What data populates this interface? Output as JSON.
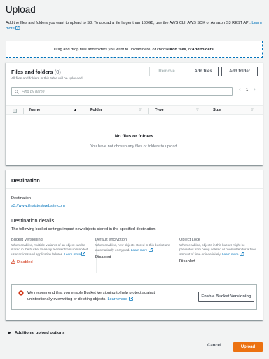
{
  "page": {
    "title": "Upload",
    "intro_text": "Add the files and folders you want to upload to S3. To upload a file larger than 160GB, use the AWS CLI, AWS SDK or Amazon S3 REST API.",
    "intro_link": "Learn more"
  },
  "dropzone": {
    "text_before": "Drag and drop files and folders you want to upload here, or choose ",
    "bold_files": "Add files",
    "text_middle": ", or ",
    "bold_folders": "Add folders",
    "text_after": "."
  },
  "files_panel": {
    "title": "Files and folders",
    "count": "(0)",
    "subtitle": "All files and folders in this table will be uploaded.",
    "remove_label": "Remove",
    "add_files_label": "Add files",
    "add_folder_label": "Add folder",
    "search_placeholder": "Find by name",
    "page_number": "1",
    "columns": [
      "Name",
      "Folder",
      "Type",
      "Size"
    ],
    "empty_title": "No files or folders",
    "empty_text": "You have not chosen any files or folders to upload."
  },
  "destination": {
    "heading": "Destination",
    "label": "Destination",
    "url": "s3://www.thisistestwebsite.com",
    "details_title": "Destination details",
    "details_subtitle": "The following bucket settings impact new objects stored in the specified destination.",
    "columns": [
      {
        "title": "Bucket Versioning",
        "desc": "When enabled, multiple variants of an object can be stored in the bucket to easily recover from unintended user actions and application failures.",
        "link": "Learn more",
        "status": "Disabled"
      },
      {
        "title": "Default encryption",
        "desc": "When enabled, new objects stored in this bucket are automatically encrypted.",
        "link": "Learn more",
        "status": "Disabled"
      },
      {
        "title": "Object Lock",
        "desc": "When enabled, objects in this bucket might be prevented from being deleted or overwritten for a fixed amount of time or indefinitely.",
        "link": "Learn more",
        "status": "Disabled"
      }
    ],
    "alert_text": "We recommend that you enable Bucket Versioning to help protect against unintentionally overwriting or deleting objects.",
    "alert_link": "Learn more",
    "alert_button": "Enable Bucket Versioning"
  },
  "footer": {
    "additional_options": "Additional upload options",
    "cancel_label": "Cancel",
    "upload_label": "Upload"
  },
  "colors": {
    "link": "#0073bb",
    "primary_button": "#ec7211",
    "warning": "#d13212",
    "background": "#f2f3f3"
  },
  "icons": {
    "external": "external-link-icon",
    "search": "search-icon",
    "warning": "warning-icon",
    "alert": "alert-error-icon",
    "caret": "caret-right-icon"
  }
}
